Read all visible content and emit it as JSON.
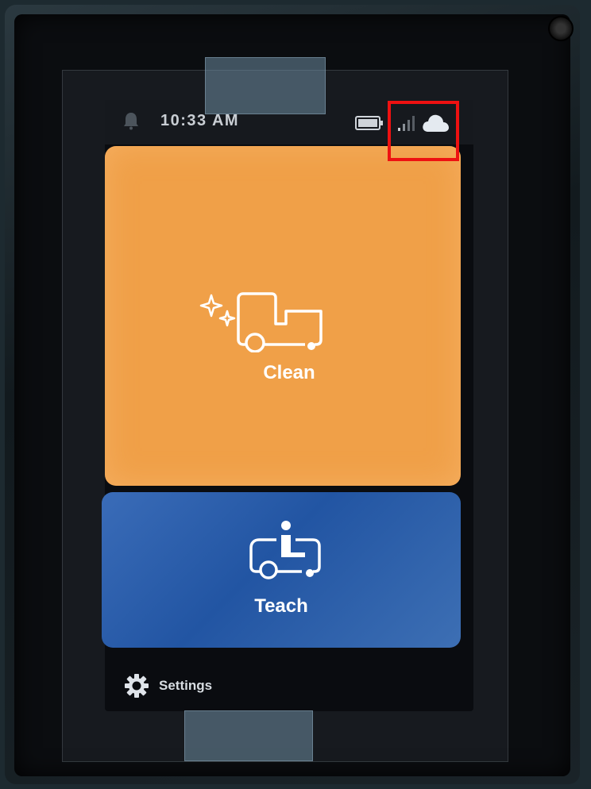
{
  "status_bar": {
    "time": "10:33 AM",
    "icons": [
      "bell-icon",
      "battery-icon",
      "signal-icon",
      "cloud-icon"
    ]
  },
  "tiles": {
    "clean": {
      "label": "Clean",
      "icon": "sparkle-truck-icon",
      "color": "#f0a048"
    },
    "teach": {
      "label": "Teach",
      "icon": "driver-truck-icon",
      "color": "#2a5ca8"
    }
  },
  "settings": {
    "label": "Settings",
    "icon": "gear-icon"
  },
  "colors": {
    "highlight": "#ee1111",
    "status_bar_bg": "#16191e"
  }
}
